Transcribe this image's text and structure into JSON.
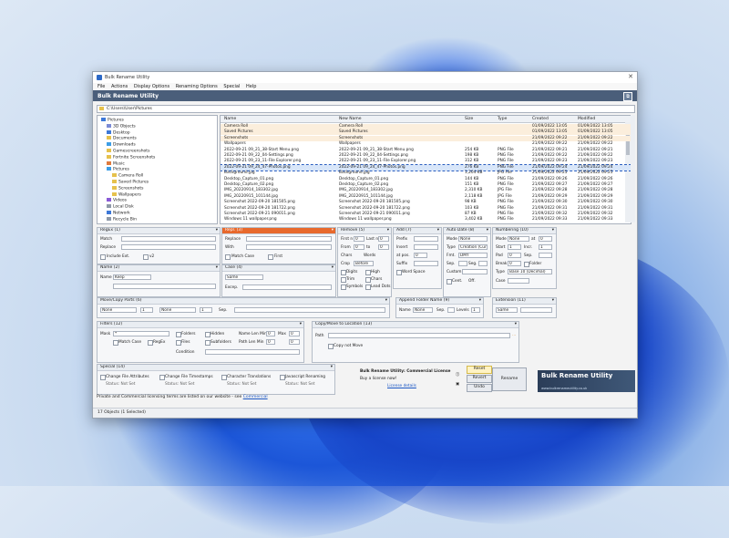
{
  "window": {
    "title": "Bulk Rename Utility",
    "banner_title": "Bulk Rename Utility",
    "close_glyph": "✕",
    "banner_icon_glyph": "⧉"
  },
  "menu": [
    "File",
    "Actions",
    "Display Options",
    "Renaming Options",
    "Special",
    "Help"
  ],
  "path": "C:\\Users\\User\\Pictures",
  "tree": [
    {
      "label": "Pictures"
    },
    {
      "label": "3D Objects"
    },
    {
      "label": "Desktop"
    },
    {
      "label": "Documents"
    },
    {
      "label": "Downloads"
    },
    {
      "label": "Gamescreenshots"
    },
    {
      "label": "Fortnite Screenshots"
    },
    {
      "label": "Music"
    },
    {
      "label": "Pictures"
    },
    {
      "label": "Camera Roll"
    },
    {
      "label": "Saved Pictures"
    },
    {
      "label": "Screenshots"
    },
    {
      "label": "Wallpapers"
    },
    {
      "label": "Videos"
    },
    {
      "label": "Local Disk"
    },
    {
      "label": "Network"
    },
    {
      "label": "Recycle Bin"
    }
  ],
  "grid": {
    "columns": [
      "Name",
      "New Name",
      "Size",
      "Type",
      "Created",
      "Modified"
    ],
    "rows": [
      {
        "name": "Camera Roll",
        "new": "Camera Roll",
        "size": "",
        "type": "",
        "created": "01/09/2022 13:05",
        "modified": "01/09/2022 13:05",
        "style": "orange"
      },
      {
        "name": "Saved Pictures",
        "new": "Saved Pictures",
        "size": "",
        "type": "",
        "created": "01/09/2022 13:05",
        "modified": "01/09/2022 13:05",
        "style": "orange"
      },
      {
        "name": "Screenshots",
        "new": "Screenshots",
        "size": "",
        "type": "",
        "created": "21/09/2022 09:22",
        "modified": "21/09/2022 09:22",
        "style": "orange"
      },
      {
        "name": "Wallpapers",
        "new": "Wallpapers",
        "size": "",
        "type": "",
        "created": "21/09/2022 09:22",
        "modified": "21/09/2022 09:22",
        "style": ""
      },
      {
        "name": "2022-09-21 09_21_38-Start Menu.png",
        "new": "2022-09-21 09_21_38-Start Menu.png",
        "size": "254 KB",
        "type": "PNG File",
        "created": "21/09/2022 09:21",
        "modified": "21/09/2022 09:21",
        "style": ""
      },
      {
        "name": "2022-09-21 09_22_04-Settings.png",
        "new": "2022-09-21 09_22_04-Settings.png",
        "size": "198 KB",
        "type": "PNG File",
        "created": "21/09/2022 09:22",
        "modified": "21/09/2022 09:22",
        "style": ""
      },
      {
        "name": "2022-09-21 09_23_11-File Explorer.png",
        "new": "2022-09-21 09_23_11-File Explorer.png",
        "size": "312 KB",
        "type": "PNG File",
        "created": "21/09/2022 09:23",
        "modified": "21/09/2022 09:23",
        "style": ""
      },
      {
        "name": "2022-09-21 09_24_47-Photos.png",
        "new": "2022-09-21 09_24_47-Photos.png",
        "size": "276 KB",
        "type": "PNG File",
        "created": "21/09/2022 09:24",
        "modified": "21/09/2022 09:24",
        "style": "sel"
      },
      {
        "name": "Background.jpg",
        "new": "Background.jpg",
        "size": "1,204 KB",
        "type": "JPG File",
        "created": "21/09/2022 09:25",
        "modified": "21/09/2022 09:25",
        "style": ""
      },
      {
        "name": "Desktop_Capture_01.png",
        "new": "Desktop_Capture_01.png",
        "size": "144 KB",
        "type": "PNG File",
        "created": "21/09/2022 09:26",
        "modified": "21/09/2022 09:26",
        "style": ""
      },
      {
        "name": "Desktop_Capture_02.png",
        "new": "Desktop_Capture_02.png",
        "size": "151 KB",
        "type": "PNG File",
        "created": "21/09/2022 09:27",
        "modified": "21/09/2022 09:27",
        "style": ""
      },
      {
        "name": "IMG_20220914_183302.jpg",
        "new": "IMG_20220914_183302.jpg",
        "size": "2,310 KB",
        "type": "JPG File",
        "created": "21/09/2022 09:28",
        "modified": "21/09/2022 09:28",
        "style": ""
      },
      {
        "name": "IMG_20220915_101144.jpg",
        "new": "IMG_20220915_101144.jpg",
        "size": "2,118 KB",
        "type": "JPG File",
        "created": "21/09/2022 09:29",
        "modified": "21/09/2022 09:29",
        "style": ""
      },
      {
        "name": "Screenshot 2022-09-20 181505.png",
        "new": "Screenshot 2022-09-20 181505.png",
        "size": "98 KB",
        "type": "PNG File",
        "created": "21/09/2022 09:30",
        "modified": "21/09/2022 09:30",
        "style": ""
      },
      {
        "name": "Screenshot 2022-09-20 181722.png",
        "new": "Screenshot 2022-09-20 181722.png",
        "size": "103 KB",
        "type": "PNG File",
        "created": "21/09/2022 09:31",
        "modified": "21/09/2022 09:31",
        "style": ""
      },
      {
        "name": "Screenshot 2022-09-21 090011.png",
        "new": "Screenshot 2022-09-21 090011.png",
        "size": "87 KB",
        "type": "PNG File",
        "created": "21/09/2022 09:32",
        "modified": "21/09/2022 09:32",
        "style": ""
      },
      {
        "name": "Windows 11 wallpaper.png",
        "new": "Windows 11 wallpaper.png",
        "size": "3,402 KB",
        "type": "PNG File",
        "created": "21/09/2022 09:33",
        "modified": "21/09/2022 09:33",
        "style": ""
      }
    ]
  },
  "panels": {
    "regex": {
      "title": "RegEx (1)",
      "match": "Match",
      "replace": "Replace",
      "include_ext": "Include Ext.",
      "v2": "v2"
    },
    "repl": {
      "title": "Repl. (3)",
      "replace": "Replace",
      "with": "With",
      "match_case": "Match Case",
      "first": "First"
    },
    "remove": {
      "title": "Remove (5)",
      "first_n": "First n",
      "last_n": "Last n",
      "from": "From",
      "to": "to",
      "chars": "Chars",
      "words": "Words",
      "crop": "Crop",
      "before": "Before",
      "digits": "Digits",
      "high": "High",
      "trim": "Trim",
      "chars2": "Chars",
      "symbols": "Symbols",
      "lead_dots": "Lead Dots",
      "none": "None"
    },
    "add": {
      "title": "Add (7)",
      "prefix": "Prefix",
      "insert": "Insert",
      "at_pos": "at pos.",
      "suffix": "Suffix",
      "word_space": "Word Space"
    },
    "autodate": {
      "title": "Auto Date (8)",
      "mode": "Mode",
      "mode_val": "None",
      "type": "Type",
      "type_val": "Creation (Curr.)",
      "fmt": "Fmt.",
      "fmt_val": "DMY",
      "sep": "Sep.",
      "seg": "Seg.",
      "custom": "Custom",
      "cent": "Cent.",
      "off": "Off."
    },
    "numbering": {
      "title": "Numbering (10)",
      "mode": "Mode",
      "mode_val": "None",
      "at": "at",
      "start": "Start",
      "incr": "Incr.",
      "pad": "Pad",
      "sep": "Sep.",
      "break": "Break",
      "folder": "Folder",
      "type": "Type",
      "type_val": "Base 10 (Decimal)",
      "case": "Case"
    },
    "case": {
      "title": "Case (4)",
      "same": "Same",
      "excep": "Excep."
    },
    "name": {
      "title": "Name (2)",
      "name": "Name",
      "keep": "Keep"
    },
    "movecopy": {
      "title": "Move/Copy Parts (6)",
      "none": "None",
      "sep": "Sep."
    },
    "appendfolder": {
      "title": "Append Folder Name (9)",
      "name": "Name",
      "none": "None",
      "sep": "Sep.",
      "levels": "Levels"
    },
    "extension": {
      "title": "Extension (11)",
      "same": "Same"
    },
    "filters": {
      "title": "Filters (12)",
      "mask": "Mask",
      "mask_val": "*",
      "folders": "Folders",
      "hidden": "Hidden",
      "files": "Files",
      "subfolders": "Subfolders",
      "name_len_min": "Name Len Min",
      "max": "Max",
      "path_len_min": "Path Len Min",
      "match_case": "Match Case",
      "regex": "RegEx",
      "condition": "Condition"
    },
    "copymove": {
      "title": "Copy/Move to Location (13)",
      "path": "Path",
      "copy_not_move": "Copy not Move"
    },
    "special": {
      "title": "Special (14)",
      "items": [
        "Change File Attributes",
        "Change File Timestamps",
        "Character Translations",
        "Javascript Renaming"
      ],
      "status": [
        "Status: Not Set",
        "Status: Not Set",
        "Status: Not Set",
        "Status: Not Set"
      ]
    }
  },
  "promo": {
    "line1": "Bulk Rename Utility: Commercial License",
    "line2": "Buy a license now!",
    "link": "License details"
  },
  "buttons": {
    "reset": "Reset",
    "revert": "Revert",
    "undo": "Undo",
    "rename": "Rename"
  },
  "logo": {
    "title": "Bulk Rename Utility",
    "subtitle": "www.bulkrenameutility.co.uk"
  },
  "statusline": {
    "text": "Private and Commercial licensing terms are listed on our website - see",
    "link": "Commercial"
  },
  "statusbar": {
    "text": "17 Objects (1 Selected)"
  }
}
